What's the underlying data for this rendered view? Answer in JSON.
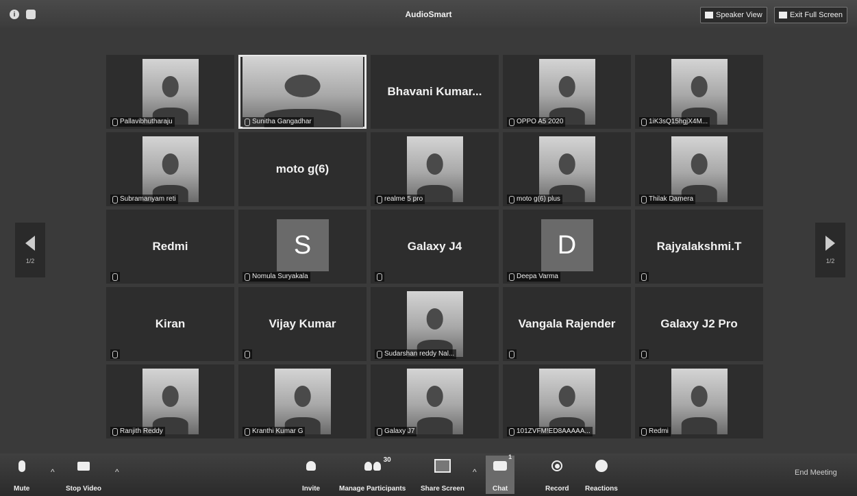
{
  "window": {
    "title": "AudioSmart",
    "speaker_view_label": "Speaker View",
    "exit_full_screen_label": "Exit Full Screen"
  },
  "pagination": {
    "left": "1/2",
    "right": "1/2"
  },
  "tiles": [
    {
      "type": "video",
      "label": "Pallavibhutharaju"
    },
    {
      "type": "video",
      "label": "Sunitha Gangadhar",
      "active": true
    },
    {
      "type": "name",
      "name": "Bhavani  Kumar..."
    },
    {
      "type": "video",
      "label": "OPPO A5 2020"
    },
    {
      "type": "video",
      "label": "1iK3sQ15hgjX4M..."
    },
    {
      "type": "video",
      "label": "Subramanyam reti"
    },
    {
      "type": "name",
      "name": "moto g(6)"
    },
    {
      "type": "video",
      "label": "realme 5 pro"
    },
    {
      "type": "video",
      "label": "moto g(6) plus"
    },
    {
      "type": "video",
      "label": "Thilak Damera"
    },
    {
      "type": "name",
      "name": "Redmi"
    },
    {
      "type": "avatar",
      "initial": "S",
      "label": "Nomula Suryakala"
    },
    {
      "type": "name",
      "name": "Galaxy J4"
    },
    {
      "type": "avatar",
      "initial": "D",
      "label": "Deepa Varma"
    },
    {
      "type": "name",
      "name": "Rajyalakshmi.T"
    },
    {
      "type": "name",
      "name": "Kiran"
    },
    {
      "type": "name",
      "name": "Vijay Kumar"
    },
    {
      "type": "video",
      "label": "Sudarshan reddy Nal..."
    },
    {
      "type": "name",
      "name": "Vangala Rajender"
    },
    {
      "type": "name",
      "name": "Galaxy J2 Pro"
    },
    {
      "type": "video",
      "label": "Ranjith Reddy"
    },
    {
      "type": "video",
      "label": "Kranthi Kumar G"
    },
    {
      "type": "video",
      "label": "Galaxy J7"
    },
    {
      "type": "video",
      "label": "101ZVFM!ED8AAAAA..."
    },
    {
      "type": "video",
      "label": "Redmi"
    }
  ],
  "toolbar": {
    "mute": "Mute",
    "stop_video": "Stop Video",
    "invite": "Invite",
    "manage_participants": "Manage Participants",
    "participants_count": "30",
    "share_screen": "Share Screen",
    "chat": "Chat",
    "chat_badge": "1",
    "record": "Record",
    "reactions": "Reactions",
    "end_meeting": "End Meeting"
  }
}
